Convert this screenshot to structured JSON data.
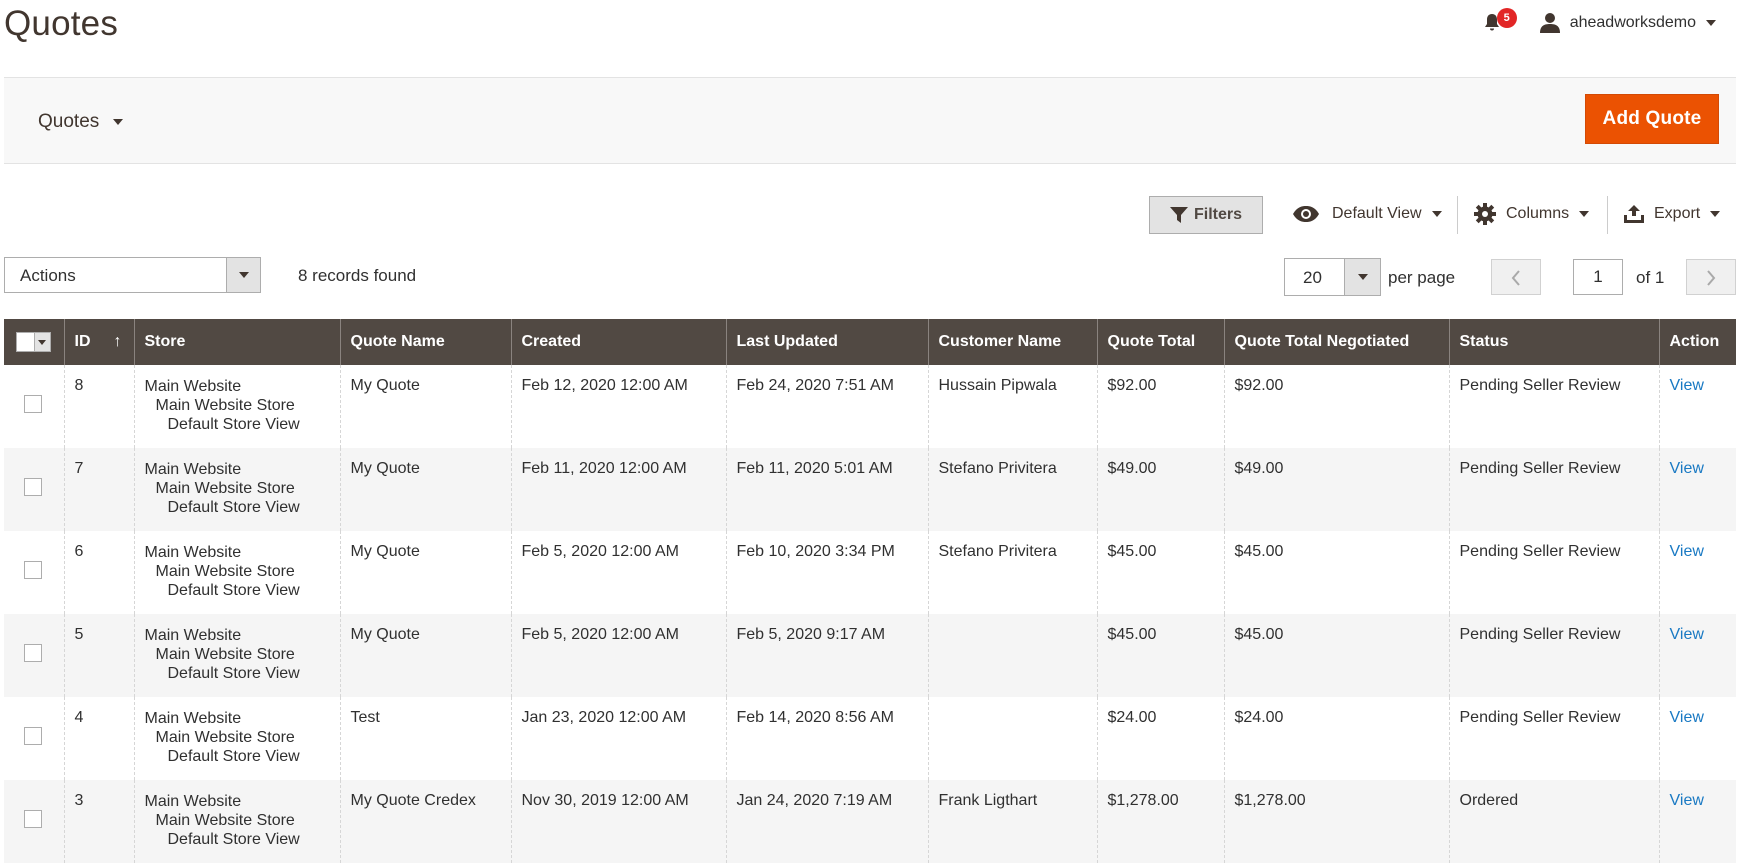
{
  "header": {
    "title": "Quotes",
    "notifications_count": "5",
    "username": "aheadworksdemo"
  },
  "action_bar": {
    "switcher_label": "Quotes",
    "add_button": "Add Quote",
    "add_button_color": "#eb5202"
  },
  "toolbar": {
    "filters": "Filters",
    "view": "Default View",
    "columns": "Columns",
    "export": "Export"
  },
  "grid_controls": {
    "actions": "Actions",
    "records_found": "8 records found",
    "per_page_value": "20",
    "per_page_label": "per page",
    "current_page": "1",
    "of_pages": "of 1"
  },
  "grid": {
    "header_bg": "#514943",
    "columns": [
      "ID",
      "Store",
      "Quote Name",
      "Created",
      "Last Updated",
      "Customer Name",
      "Quote Total",
      "Quote Total Negotiated",
      "Status",
      "Action"
    ],
    "sort_indicator": "↑",
    "rows": [
      {
        "id": "8",
        "store": [
          "Main Website",
          "Main Website Store",
          "Default Store View"
        ],
        "quote_name": "My Quote",
        "created": "Feb 12, 2020 12:00 AM",
        "updated": "Feb 24, 2020 7:51 AM",
        "customer": "Hussain Pipwala",
        "total": "$92.00",
        "negotiated": "$92.00",
        "status": "Pending Seller Review",
        "action": "View"
      },
      {
        "id": "7",
        "store": [
          "Main Website",
          "Main Website Store",
          "Default Store View"
        ],
        "quote_name": "My Quote",
        "created": "Feb 11, 2020 12:00 AM",
        "updated": "Feb 11, 2020 5:01 AM",
        "customer": "Stefano Privitera",
        "total": "$49.00",
        "negotiated": "$49.00",
        "status": "Pending Seller Review",
        "action": "View"
      },
      {
        "id": "6",
        "store": [
          "Main Website",
          "Main Website Store",
          "Default Store View"
        ],
        "quote_name": "My Quote",
        "created": "Feb 5, 2020 12:00 AM",
        "updated": "Feb 10, 2020 3:34 PM",
        "customer": "Stefano Privitera",
        "total": "$45.00",
        "negotiated": "$45.00",
        "status": "Pending Seller Review",
        "action": "View"
      },
      {
        "id": "5",
        "store": [
          "Main Website",
          "Main Website Store",
          "Default Store View"
        ],
        "quote_name": "My Quote",
        "created": "Feb 5, 2020 12:00 AM",
        "updated": "Feb 5, 2020 9:17 AM",
        "customer": "",
        "total": "$45.00",
        "negotiated": "$45.00",
        "status": "Pending Seller Review",
        "action": "View"
      },
      {
        "id": "4",
        "store": [
          "Main Website",
          "Main Website Store",
          "Default Store View"
        ],
        "quote_name": "Test",
        "created": "Jan 23, 2020 12:00 AM",
        "updated": "Feb 14, 2020 8:56 AM",
        "customer": "",
        "total": "$24.00",
        "negotiated": "$24.00",
        "status": "Pending Seller Review",
        "action": "View"
      },
      {
        "id": "3",
        "store": [
          "Main Website",
          "Main Website Store",
          "Default Store View"
        ],
        "quote_name": "My Quote Credex",
        "created": "Nov 30, 2019 12:00 AM",
        "updated": "Jan 24, 2020 7:19 AM",
        "customer": "Frank Ligthart",
        "total": "$1,278.00",
        "negotiated": "$1,278.00",
        "status": "Ordered",
        "action": "View"
      }
    ]
  }
}
